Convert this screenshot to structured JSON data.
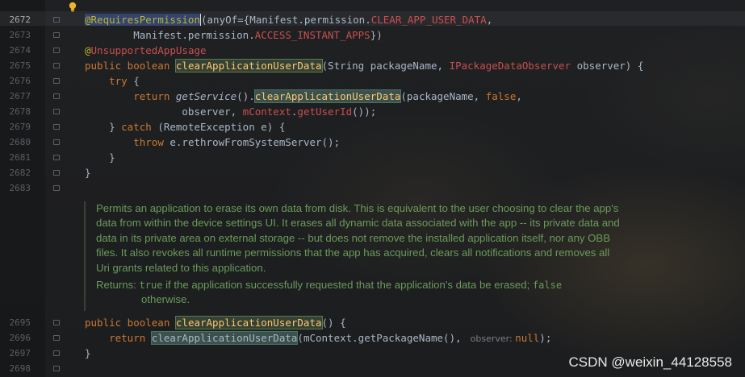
{
  "editor": {
    "lines": [
      {
        "num": "",
        "t": [
          {
            "c": "",
            "s": ""
          }
        ]
      },
      {
        "num": "2672",
        "current": true,
        "t": [
          {
            "c": "@RequiresPermission",
            "s": "annhl"
          },
          {
            "c": "(anyOf={Manifest.permission.",
            "s": "caretbefore"
          },
          {
            "c": "CLEAR_APP_USER_DATA",
            "s": "const"
          },
          {
            "c": ",",
            "s": ""
          }
        ]
      },
      {
        "num": "2673",
        "t": [
          {
            "c": "        Manifest.permission.",
            "s": ""
          },
          {
            "c": "ACCESS_INSTANT_APPS",
            "s": "const"
          },
          {
            "c": "})",
            "s": ""
          }
        ]
      },
      {
        "num": "2674",
        "t": [
          {
            "c": "@",
            "s": "ann"
          },
          {
            "c": "UnsupportedAppUsage",
            "s": "const"
          }
        ]
      },
      {
        "num": "2675",
        "t": [
          {
            "c": "public boolean ",
            "s": "kw"
          },
          {
            "c": "clearApplicationUserData",
            "s": "decl-hl"
          },
          {
            "c": "(String packageName, ",
            "s": ""
          },
          {
            "c": "IPackageDataObserver",
            "s": "const"
          },
          {
            "c": " observer) {",
            "s": ""
          }
        ]
      },
      {
        "num": "2676",
        "t": [
          {
            "c": "    ",
            "s": ""
          },
          {
            "c": "try",
            "s": "kw"
          },
          {
            "c": " {",
            "s": ""
          }
        ]
      },
      {
        "num": "2677",
        "t": [
          {
            "c": "        ",
            "s": ""
          },
          {
            "c": "return ",
            "s": "kw"
          },
          {
            "c": "getService",
            "s": "italic"
          },
          {
            "c": "().",
            "s": ""
          },
          {
            "c": "clearApplicationUserData",
            "s": "methodhl"
          },
          {
            "c": "(packageName, ",
            "s": ""
          },
          {
            "c": "false",
            "s": "kw"
          },
          {
            "c": ",",
            "s": ""
          }
        ]
      },
      {
        "num": "2678",
        "t": [
          {
            "c": "                observer, ",
            "s": ""
          },
          {
            "c": "mContext",
            "s": "field"
          },
          {
            "c": ".",
            "s": ""
          },
          {
            "c": "getUserId",
            "s": "field"
          },
          {
            "c": "());",
            "s": ""
          }
        ]
      },
      {
        "num": "2679",
        "t": [
          {
            "c": "    } ",
            "s": ""
          },
          {
            "c": "catch",
            "s": "kw"
          },
          {
            "c": " (RemoteException e) {",
            "s": ""
          }
        ]
      },
      {
        "num": "2680",
        "t": [
          {
            "c": "        ",
            "s": ""
          },
          {
            "c": "throw",
            "s": "kw"
          },
          {
            "c": " e.rethrowFromSystemServer();",
            "s": ""
          }
        ]
      },
      {
        "num": "2681",
        "t": [
          {
            "c": "    }",
            "s": ""
          }
        ]
      },
      {
        "num": "2682",
        "t": [
          {
            "c": "}",
            "s": ""
          }
        ]
      },
      {
        "num": "2683",
        "t": [
          {
            "c": "",
            "s": ""
          }
        ]
      }
    ],
    "lines2": [
      {
        "num": "2695",
        "t": [
          {
            "c": "public boolean ",
            "s": "kw"
          },
          {
            "c": "clearApplicationUserData",
            "s": "decl-hl"
          },
          {
            "c": "() {",
            "s": ""
          }
        ]
      },
      {
        "num": "2696",
        "t": [
          {
            "c": "    ",
            "s": ""
          },
          {
            "c": "return ",
            "s": "kw"
          },
          {
            "c": "clearApplicationUserData",
            "s": "methodhl2"
          },
          {
            "c": "(mContext.getPackageName(), ",
            "s": ""
          },
          {
            "c": " observer: ",
            "s": "hint"
          },
          {
            "c": "null",
            "s": "kw"
          },
          {
            "c": ");",
            "s": ""
          }
        ]
      },
      {
        "num": "2697",
        "t": [
          {
            "c": "}",
            "s": ""
          }
        ]
      },
      {
        "num": "2698",
        "t": [
          {
            "c": "",
            "s": ""
          }
        ]
      }
    ]
  },
  "doc": {
    "body": "Permits an application to erase its own data from disk. This is equivalent to the user choosing to clear the app's data from within the device settings UI. It erases all dynamic data associated with the app -- its private data and data in its private area on external storage -- but does not remove the installed application itself, nor any OBB files. It also revokes all runtime permissions that the app has acquired, clears all notifications and removes all Uri grants related to this application.",
    "returns_label": "Returns:",
    "returns_code1": "true",
    "returns_text": " if the application successfully requested that the application's data be erased; ",
    "returns_code2": "false",
    "returns_cont": "otherwise."
  },
  "watermark": "CSDN @weixin_44128558",
  "colors": {
    "background": "#1d1e20",
    "keyword": "#cc7832",
    "method": "#ffc66d",
    "constant": "#c94f4f",
    "doc_comment": "#6a9a5a",
    "line_number": "#5b5e63"
  },
  "icons": [
    "lightbulb-icon",
    "fold-marker-icon"
  ]
}
